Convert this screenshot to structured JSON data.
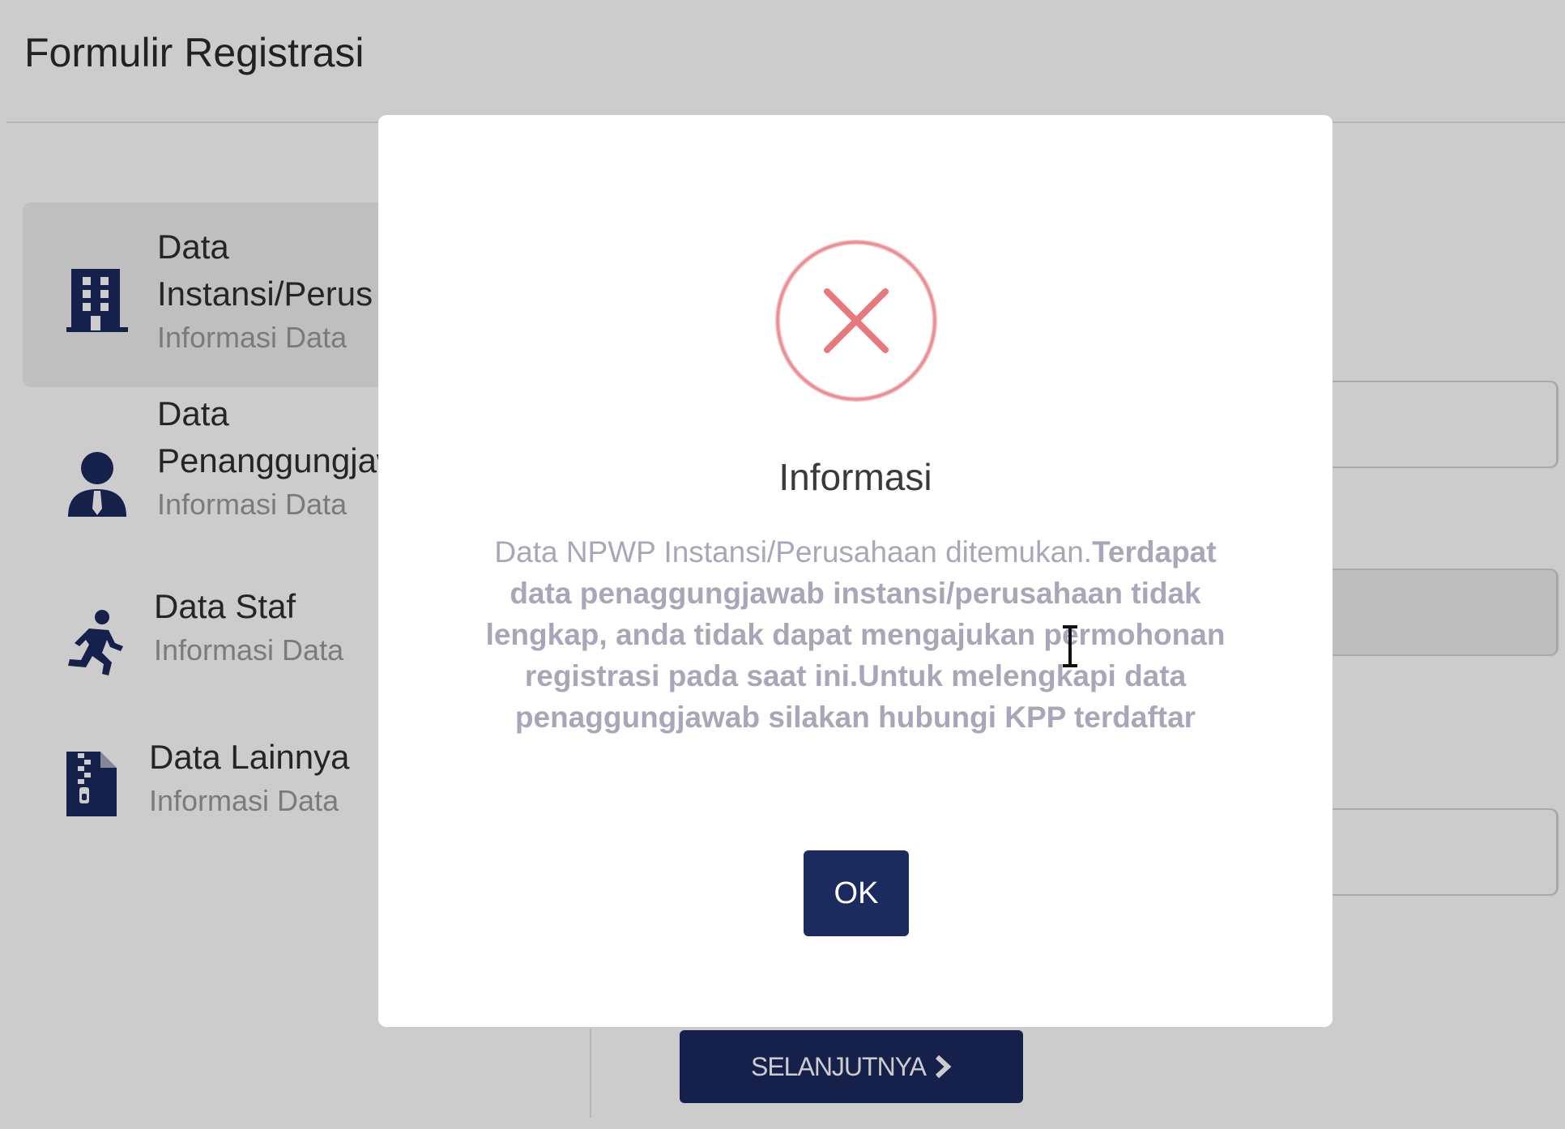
{
  "page": {
    "title": "Formulir Registrasi"
  },
  "steps": [
    {
      "title_line1": "Data",
      "title_line2": "Instansi/Perus",
      "subtitle": "Informasi Data",
      "icon": "building-icon",
      "active": true
    },
    {
      "title_line1": "Data",
      "title_line2": "Penanggungjaw",
      "subtitle": "Informasi Data",
      "icon": "person-tie-icon",
      "active": false
    },
    {
      "title_line1": "Data Staf",
      "subtitle": "Informasi Data",
      "icon": "running-person-icon",
      "active": false
    },
    {
      "title_line1": "Data Lainnya",
      "subtitle": "Informasi Data",
      "icon": "zip-file-icon",
      "active": false
    }
  ],
  "footer": {
    "next_label": "SELANJUTNYA"
  },
  "modal": {
    "icon": "error-x-icon",
    "title": "Informasi",
    "message_plain": "Data NPWP Instansi/Perusahaan ditemukan.",
    "message_bold": "Terdapat data penaggungjawab instansi/perusahaan tidak lengkap, anda tidak dapat mengajukan permohonan registrasi pada saat ini.Untuk melengkapi data penaggungjawab silakan hubungi KPP terdaftar",
    "ok_label": "OK"
  },
  "colors": {
    "primary": "#1c2a5e",
    "error": "#e8787c",
    "muted_text": "#a7a7b9"
  }
}
